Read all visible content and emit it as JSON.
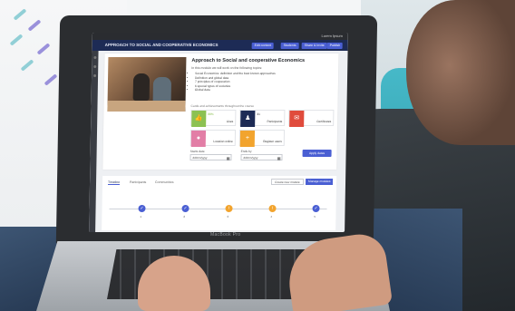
{
  "colors": {
    "accent": "#4a5fd3",
    "appbar": "#1d2b55",
    "green": "#8cc152",
    "navy": "#1d2b55",
    "red": "#e04b3c",
    "pink": "#e27ea6",
    "orange": "#f2a42e",
    "done_node": "#4a5fd3",
    "pending_node": "#f2a42e"
  },
  "laptop": {
    "brand": "MacBook Pro"
  },
  "screen": {
    "topbar": {
      "user": "Lorem Ipsum"
    },
    "appbar": {
      "title": "APPROACH TO SOCIAL AND COOPERATIVE ECONOMICS",
      "buttons": [
        "Edit content",
        "Students",
        "Share & Invite",
        "Publish"
      ]
    },
    "course": {
      "title": "Approach to Social and cooperative Economics",
      "intro": "In this module we will work on the following topics:",
      "topics": [
        "Social Economics: definition and the best known approaches",
        "Definition and global data",
        "7 principles of cooperation",
        "6 special types of societies",
        "Global data"
      ],
      "tiles_caption": "Cards and achievements throughout the course",
      "tiles": [
        {
          "icon": "thumbs-up-icon",
          "sub": "88%",
          "label": "Likes"
        },
        {
          "icon": "users-icon",
          "sub": "31",
          "label": "Participants"
        },
        {
          "icon": "certificate-icon",
          "sub": "",
          "label": "Certificates"
        },
        {
          "icon": "location-pin-icon",
          "sub": "",
          "label": "Location online"
        },
        {
          "icon": "user-add-icon",
          "sub": "",
          "label": "Register users"
        }
      ]
    },
    "dates": {
      "from_label": "Starts date",
      "to_label": "Ends by",
      "from_value": "dd/mm/yyyy",
      "to_value": "dd/mm/yyyy",
      "apply": "Apply dates"
    },
    "timeline": {
      "tabs": [
        "Timeline",
        "Participants",
        "Communities"
      ],
      "actions": [
        "Create new module",
        "Manage modules"
      ],
      "nodes": [
        {
          "state": "done",
          "label": "1"
        },
        {
          "state": "done",
          "label": "2"
        },
        {
          "state": "pending",
          "label": "3"
        },
        {
          "state": "pending",
          "label": "4"
        },
        {
          "state": "done",
          "label": "5"
        }
      ]
    }
  }
}
